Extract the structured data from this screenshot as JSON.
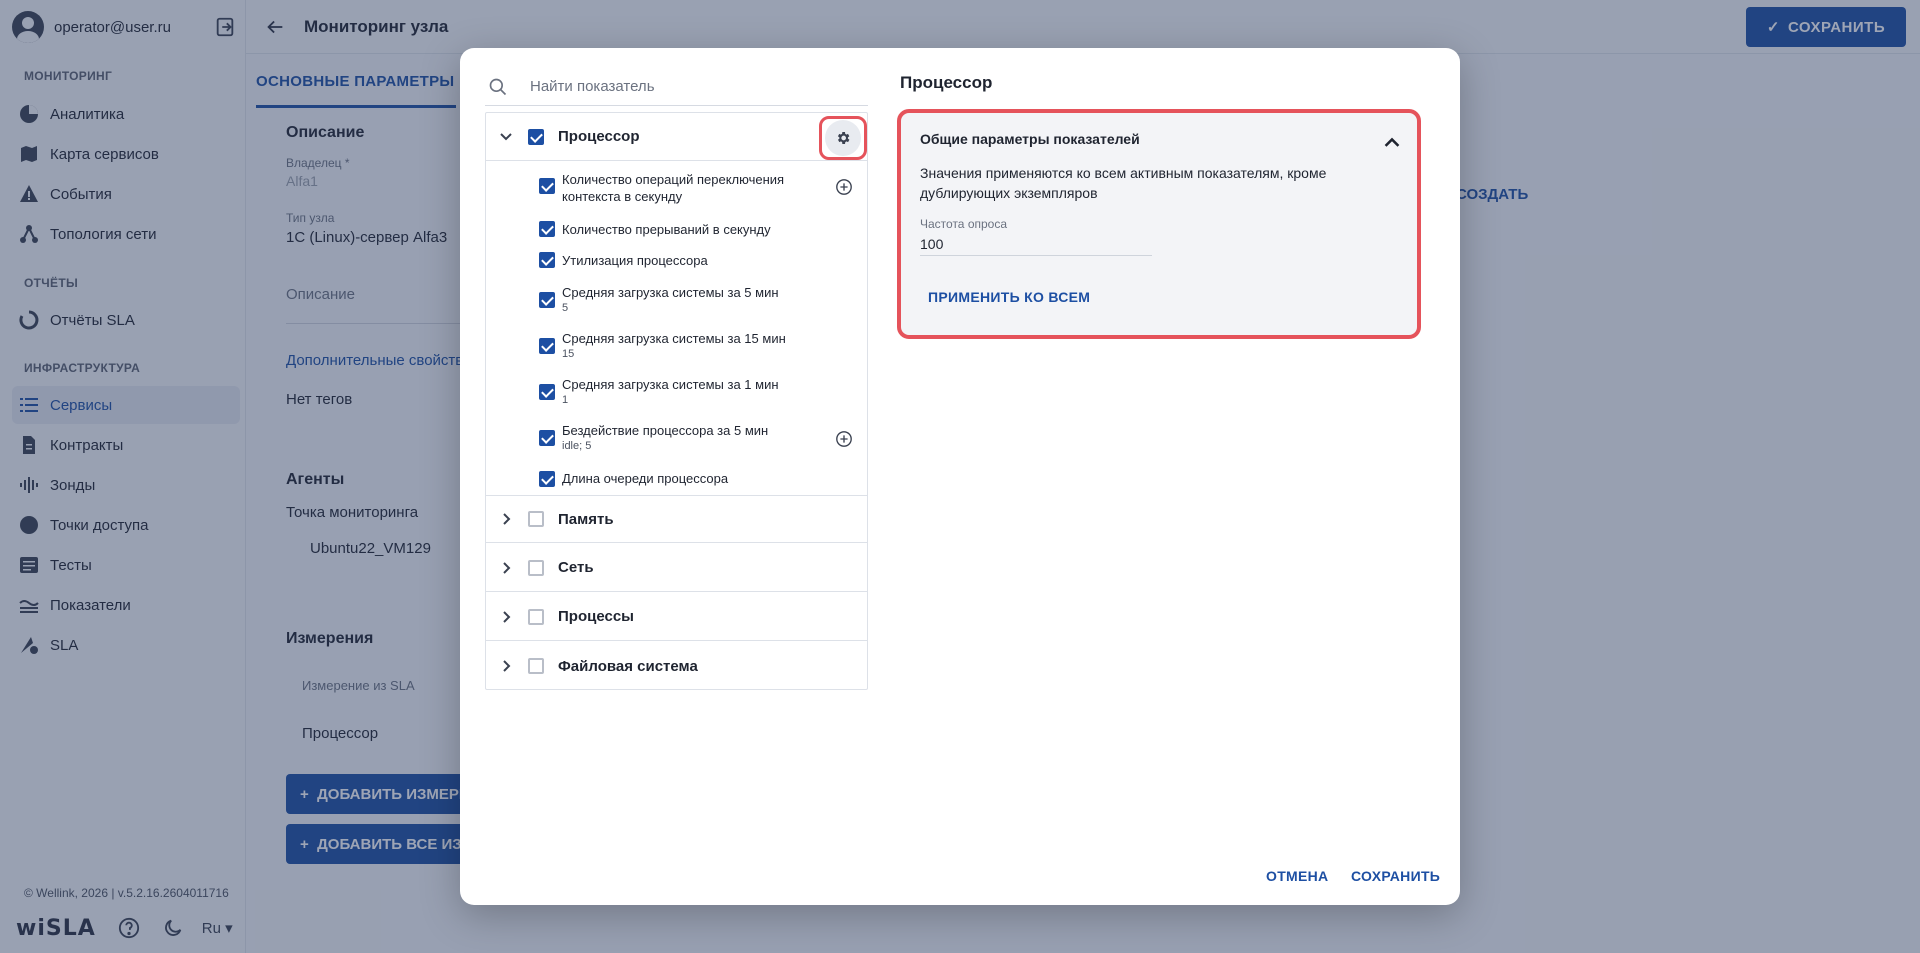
{
  "user": {
    "email": "operator@user.ru"
  },
  "sidebar": {
    "sections": [
      {
        "title": "МОНИТОРИНГ"
      },
      {
        "title": "ОТЧЁТЫ"
      },
      {
        "title": "ИНФРАСТРУКТУРА"
      }
    ],
    "items": [
      {
        "label": "Аналитика",
        "icon": "pie-chart-icon"
      },
      {
        "label": "Карта сервисов",
        "icon": "map-icon"
      },
      {
        "label": "События",
        "icon": "warning-icon"
      },
      {
        "label": "Топология сети",
        "icon": "topology-icon"
      },
      {
        "label": "Отчёты SLA",
        "icon": "refresh-circle-icon"
      },
      {
        "label": "Сервисы",
        "icon": "list-icon",
        "active": true
      },
      {
        "label": "Контракты",
        "icon": "document-icon"
      },
      {
        "label": "Зонды",
        "icon": "probe-icon"
      },
      {
        "label": "Точки доступа",
        "icon": "circle-icon"
      },
      {
        "label": "Тесты",
        "icon": "tests-icon"
      },
      {
        "label": "Показатели",
        "icon": "metrics-icon"
      },
      {
        "label": "SLA",
        "icon": "sla-icon"
      }
    ],
    "footer": {
      "copyright": "© Wellink, 2026 | v.5.2.16.2604011716",
      "brand": "wiSLA",
      "lang": "Ru"
    }
  },
  "header": {
    "title": "Мониторинг узла",
    "save_label": "СОХРАНИТЬ"
  },
  "main": {
    "tab": "ОСНОВНЫЕ ПАРАМЕТРЫ",
    "description_title": "Описание",
    "owner_label": "Владелец *",
    "owner_value": "Alfa1",
    "node_type_label": "Тип узла",
    "node_type_value": "1С (Linux)-сервер Alfa3",
    "description_placeholder": "Описание",
    "additional_props": "Дополнительные свойства",
    "no_tags": "Нет тегов",
    "agents_title": "Агенты",
    "monitoring_point_label": "Точка мониторинга",
    "monitoring_point_value": "Ubuntu22_VM129",
    "measurements_title": "Измерения",
    "measurement_col": "Измерение из SLA",
    "measurement_row": "Процессор",
    "add_measure": "ДОБАВИТЬ ИЗМЕРЕНИЕ",
    "add_all": "ДОБАВИТЬ ВСЕ ИЗМЕРЕНИЯ",
    "create": "СОЗДАТЬ"
  },
  "dialog": {
    "search_placeholder": "Найти показатель",
    "groups": [
      {
        "label": "Процессор",
        "checked": true,
        "expanded": true
      },
      {
        "label": "Память",
        "checked": false
      },
      {
        "label": "Сеть",
        "checked": false
      },
      {
        "label": "Процессы",
        "checked": false
      },
      {
        "label": "Файловая система",
        "checked": false
      }
    ],
    "metrics": [
      {
        "label": "Количество операций переключения контекста в секунду",
        "sub": ""
      },
      {
        "label": "Количество прерываний в секунду",
        "sub": ""
      },
      {
        "label": "Утилизация процессора",
        "sub": ""
      },
      {
        "label": "Средняя загрузка системы за 5 мин",
        "sub": "5"
      },
      {
        "label": "Средняя загрузка системы за 15 мин",
        "sub": "15"
      },
      {
        "label": "Средняя загрузка системы за 1 мин",
        "sub": "1"
      },
      {
        "label": "Бездействие процессора за 5 мин",
        "sub": "idle; 5"
      },
      {
        "label": "Длина очереди процессора",
        "sub": ""
      }
    ],
    "panel": {
      "title": "Процессор",
      "box_title": "Общие параметры показателей",
      "box_text": "Значения применяются ко всем активным показателям, кроме дублирующих экземпляров",
      "poll_label": "Частота опроса",
      "poll_value": "100",
      "apply_all": "ПРИМЕНИТЬ КО ВСЕМ"
    },
    "cancel": "ОТМЕНА",
    "save": "СОХРАНИТЬ"
  },
  "colors": {
    "accent": "#1d4fa3",
    "highlight": "#e5535b",
    "overlay": "#28375a"
  }
}
